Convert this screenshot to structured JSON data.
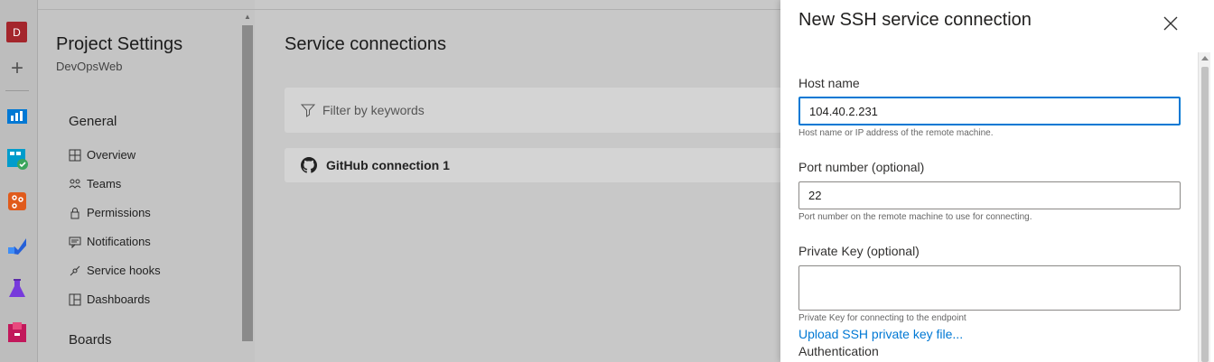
{
  "rail": {
    "org_initial": "D",
    "colors": {
      "org": "#a4262c",
      "overview": "#0078d4",
      "boards": "#009ccc",
      "repos": "#e05b1c",
      "pipelines": "#2560d8",
      "testplans": "#773adc",
      "artifacts": "#c2185b"
    }
  },
  "sidebar": {
    "title": "Project Settings",
    "subtitle": "DevOpsWeb",
    "general_label": "General",
    "items": [
      {
        "label": "Overview",
        "icon": "overview-icon"
      },
      {
        "label": "Teams",
        "icon": "teams-icon"
      },
      {
        "label": "Permissions",
        "icon": "lock-icon"
      },
      {
        "label": "Notifications",
        "icon": "notifications-icon"
      },
      {
        "label": "Service hooks",
        "icon": "service-hooks-icon"
      },
      {
        "label": "Dashboards",
        "icon": "dashboards-icon"
      }
    ],
    "boards_label": "Boards"
  },
  "main": {
    "heading": "Service connections",
    "filter_placeholder": "Filter by keywords",
    "connections": [
      {
        "name": "GitHub connection 1",
        "icon": "github-icon"
      }
    ]
  },
  "panel": {
    "title": "New SSH service connection",
    "host": {
      "label": "Host name",
      "value": "104.40.2.231",
      "hint": "Host name or IP address of the remote machine."
    },
    "port": {
      "label": "Port number (optional)",
      "value": "22",
      "hint": "Port number on the remote machine to use for connecting."
    },
    "key": {
      "label": "Private Key (optional)",
      "value": "",
      "hint": "Private Key for connecting to the endpoint"
    },
    "upload_link": "Upload SSH private key file...",
    "auth_label": "Authentication",
    "accent": "#0078d4"
  }
}
